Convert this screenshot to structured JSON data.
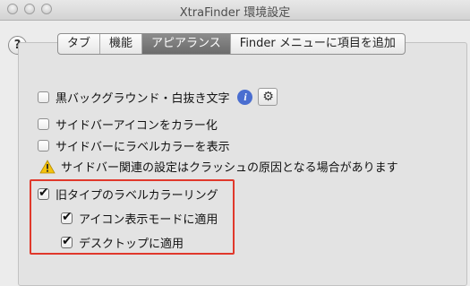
{
  "window": {
    "title": "XtraFinder 環境設定",
    "help_label": "?"
  },
  "tabs": [
    {
      "label": "タブ",
      "active": false
    },
    {
      "label": "機能",
      "active": false
    },
    {
      "label": "アピアランス",
      "active": true
    },
    {
      "label": "Finder メニューに項目を追加",
      "active": false
    }
  ],
  "options": {
    "black_background": {
      "label": "黒バックグラウンド・白抜き文字",
      "checked": false
    },
    "sidebar_icon_color": {
      "label": "サイドバーアイコンをカラー化",
      "checked": false
    },
    "sidebar_label_color": {
      "label": "サイドバーにラベルカラーを表示",
      "checked": false
    },
    "warning_text": "サイドバー関連の設定はクラッシュの原因となる場合があります",
    "old_label_ring": {
      "label": "旧タイプのラベルカラーリング",
      "checked": true
    },
    "apply_icon_mode": {
      "label": "アイコン表示モードに適用",
      "checked": true
    },
    "apply_desktop": {
      "label": "デスクトップに適用",
      "checked": true
    }
  },
  "icons": {
    "info": "i",
    "gear": "⚙"
  },
  "colors": {
    "highlight": "#e0382b",
    "info_icon": "#4a6ed0",
    "warning": "#f4c20d"
  }
}
